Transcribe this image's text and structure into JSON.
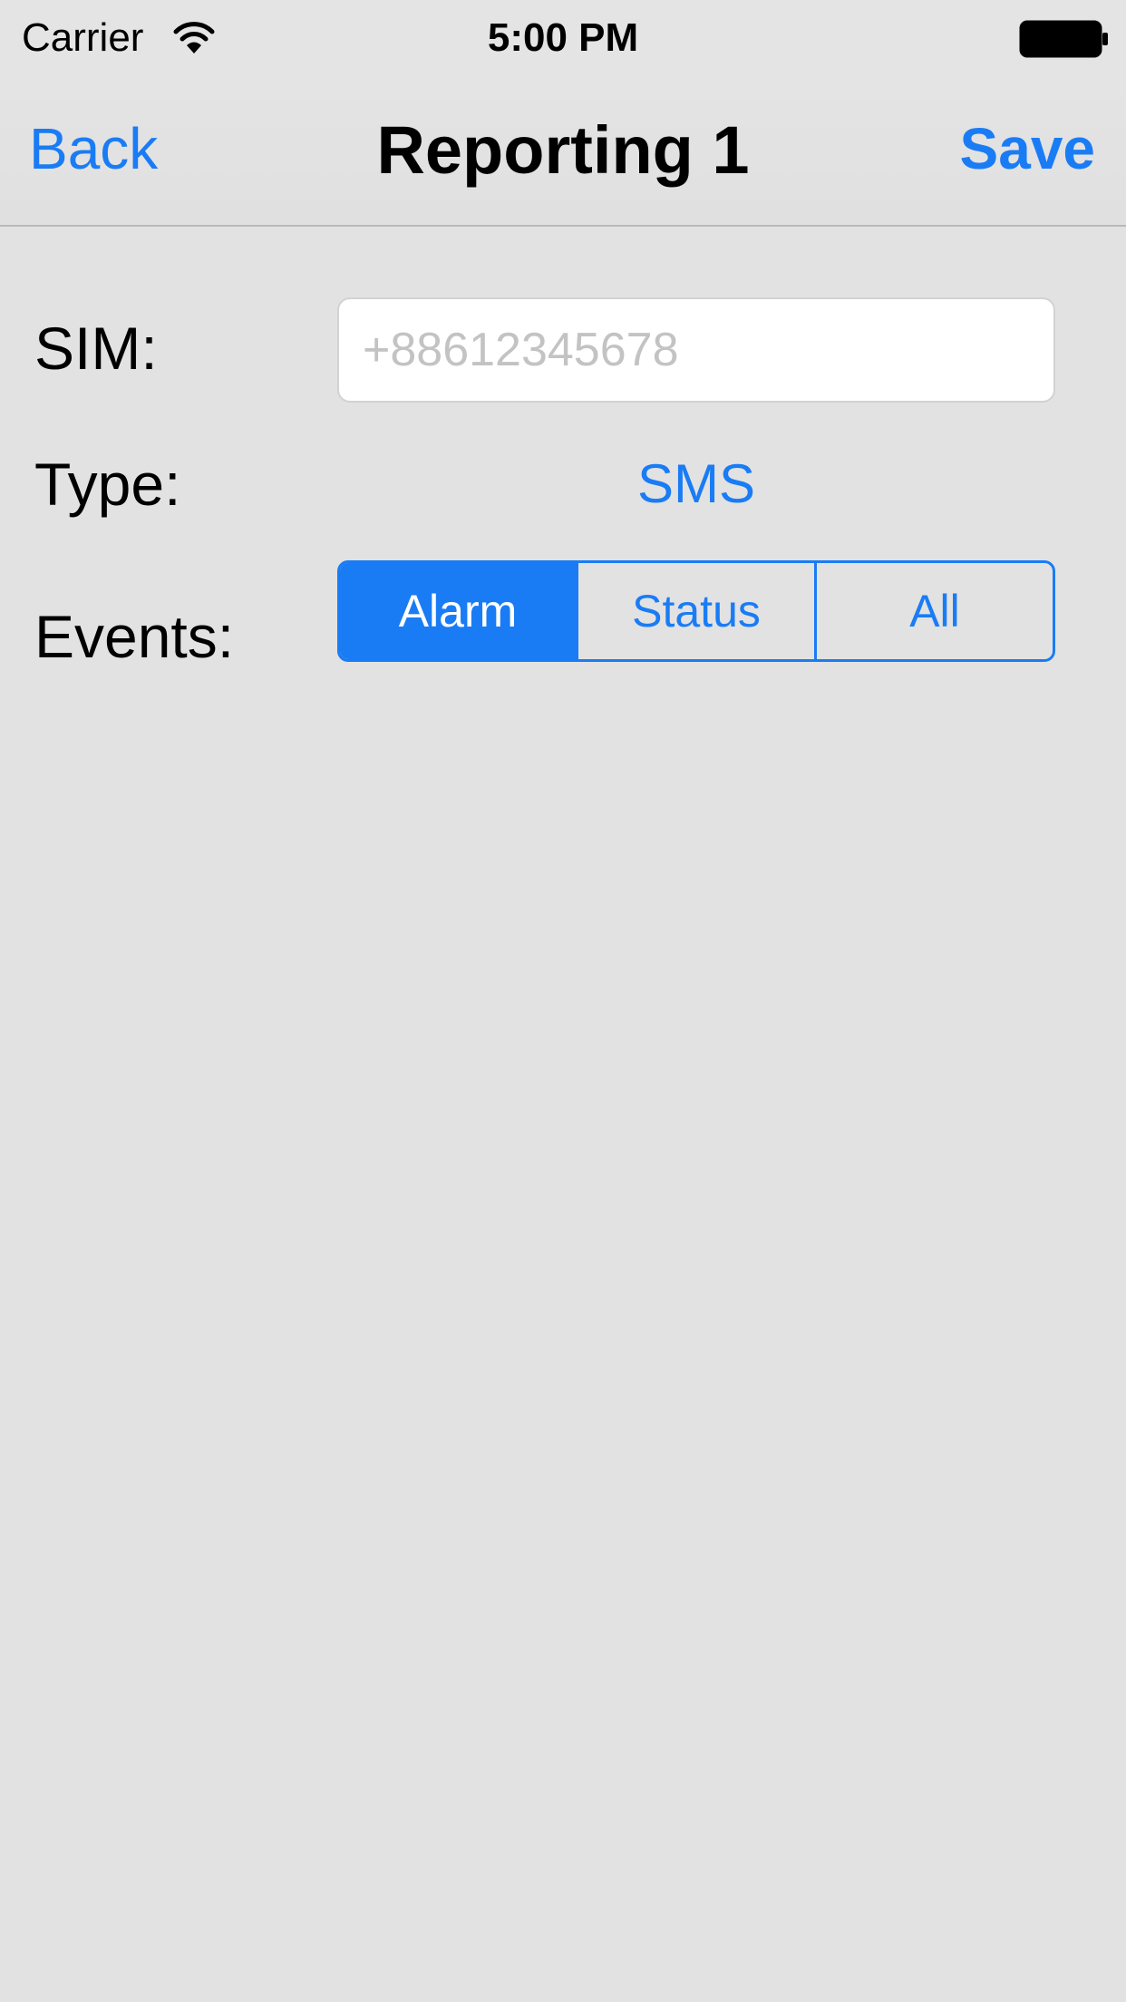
{
  "status_bar": {
    "carrier": "Carrier",
    "time": "5:00 PM",
    "icons": [
      "wifi-icon",
      "battery-icon"
    ]
  },
  "nav": {
    "back_label": "Back",
    "title": "Reporting 1",
    "save_label": "Save"
  },
  "form": {
    "sim_label": "SIM:",
    "sim_value": "",
    "sim_placeholder": "+88612345678",
    "type_label": "Type:",
    "type_value": "SMS",
    "events_label": "Events:",
    "events_options": [
      "Alarm",
      "Status",
      "All"
    ],
    "events_selected": "Alarm"
  },
  "colors": {
    "accent": "#1a7cf5",
    "background": "#e2e2e2",
    "placeholder": "#c3c3c3"
  }
}
